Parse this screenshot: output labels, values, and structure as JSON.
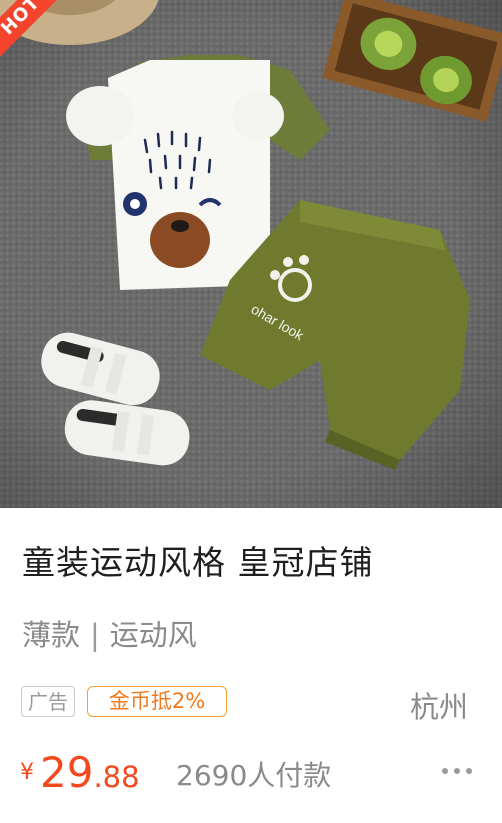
{
  "product": {
    "hot_label": "HOT",
    "title": "童装运动风格 皇冠店铺",
    "tags": [
      "薄款",
      "运动风"
    ],
    "tag_separator": "|",
    "ad_label": "广告",
    "coin_label": "金币抵2%",
    "location": "杭州",
    "price_symbol": "¥",
    "price_int": "29",
    "price_dec": ".88",
    "sales": "2690人付款",
    "photo_print_text": "ohar look"
  },
  "colors": {
    "accent": "#f5481f",
    "coin": "#f07a1c",
    "hot_badge": "#f5432c",
    "muted": "#8a8a8a"
  },
  "icons": {
    "more": "more-dots-icon"
  }
}
